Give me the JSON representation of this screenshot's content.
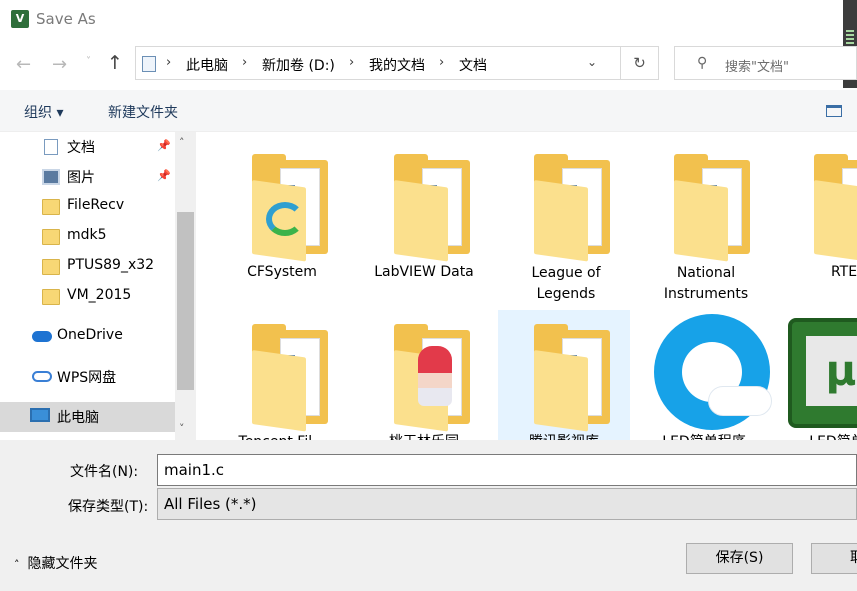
{
  "window": {
    "title": "Save As",
    "app_icon": "V"
  },
  "nav": {
    "back_icon": "←",
    "forward_icon": "→",
    "dropdown_icon": "˅",
    "up_icon": "↑",
    "breadcrumbs": [
      "此电脑",
      "新加卷 (D:)",
      "我的文档",
      "文档"
    ],
    "separator": "›",
    "address_dropdown_icon": "⌄",
    "refresh_icon": "↻"
  },
  "search": {
    "icon": "⚲",
    "placeholder": "搜索\"文档\""
  },
  "toolbar": {
    "organize_label": "组织 ▾",
    "new_folder_label": "新建文件夹"
  },
  "sidebar": {
    "items": [
      {
        "label": "文档",
        "icon": "document-icon",
        "pinned": true
      },
      {
        "label": "图片",
        "icon": "pictures-icon",
        "pinned": true
      },
      {
        "label": "FileRecv",
        "icon": "folder-icon"
      },
      {
        "label": "mdk5",
        "icon": "folder-icon"
      },
      {
        "label": "PTUS89_x32",
        "icon": "folder-icon"
      },
      {
        "label": "VM_2015",
        "icon": "folder-icon"
      },
      {
        "label": "OneDrive",
        "icon": "onedrive-icon"
      },
      {
        "label": "WPS网盘",
        "icon": "wps-cloud-icon"
      },
      {
        "label": "此电脑",
        "icon": "computer-icon",
        "selected": true
      }
    ],
    "pin_glyph": "📌",
    "scroll_up": "˄",
    "scroll_down": "˅"
  },
  "files": [
    {
      "label": "CFSystem"
    },
    {
      "label": "LabVIEW Data"
    },
    {
      "label": "League of Legends"
    },
    {
      "label": "National Instruments"
    },
    {
      "label": "RTE"
    },
    {
      "label": "Tencent Fil..."
    },
    {
      "label": "桃玉林乐园"
    },
    {
      "label": "腾讯影视库"
    },
    {
      "label": "LED简单程序"
    },
    {
      "label": "LED简单程"
    }
  ],
  "bottom": {
    "filename_label": "文件名(N):",
    "filename_value": "main1.c",
    "filetype_label": "保存类型(T):",
    "filetype_value": "All Files (*.*)",
    "hide_folders_label": "隐藏文件夹",
    "hide_chevron": "˄",
    "save_label": "保存(S)",
    "cancel_label": "取"
  },
  "colors": {
    "folder": "#f2c14e",
    "accent": "#1e395b",
    "selection": "#e5f3ff"
  }
}
